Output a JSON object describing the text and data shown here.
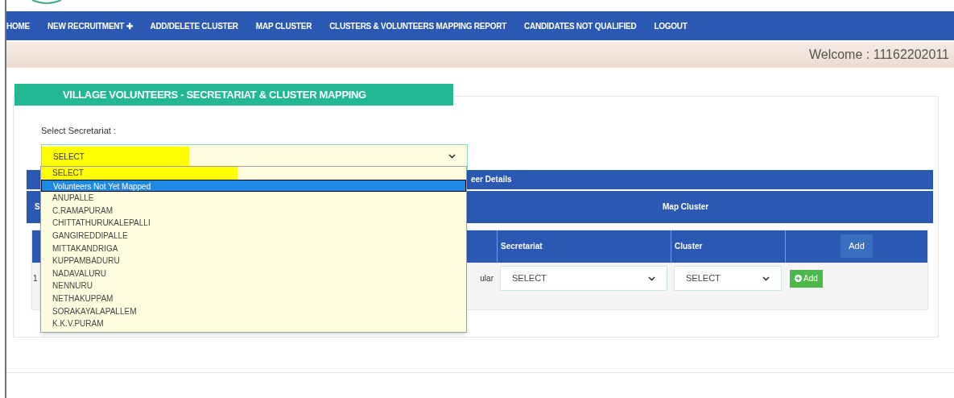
{
  "nav": {
    "items": [
      {
        "label": "HOME"
      },
      {
        "label": "NEW RECRUITMENT ✚"
      },
      {
        "label": "ADD/DELETE CLUSTER"
      },
      {
        "label": "MAP CLUSTER"
      },
      {
        "label": "CLUSTERS & VOLUNTEERS MAPPING REPORT"
      },
      {
        "label": "CANDIDATES NOT QUALIFIED"
      },
      {
        "label": "LOGOUT"
      }
    ]
  },
  "welcome": "Welcome : 11162202011",
  "panel_title": "VILLAGE VOLUNTEERS - SECRETARIAT & CLUSTER MAPPING",
  "secretariat_field": {
    "label": "Select Secretariat :",
    "value": "SELECT",
    "highlighted": true,
    "options": [
      {
        "label": "SELECT",
        "hovered": false,
        "highlighted": true
      },
      {
        "label": "Volunteers Not Yet Mapped",
        "hovered": true,
        "highlighted": false
      },
      {
        "label": "ANUPALLE",
        "hovered": false,
        "highlighted": false
      },
      {
        "label": "C.RAMAPURAM",
        "hovered": false,
        "highlighted": false
      },
      {
        "label": "CHITTATHURUKALEPALLI",
        "hovered": false,
        "highlighted": false
      },
      {
        "label": "GANGIREDDIPALLE",
        "hovered": false,
        "highlighted": false
      },
      {
        "label": "MITTAKANDRIGA",
        "hovered": false,
        "highlighted": false
      },
      {
        "label": "KUPPAMBADURU",
        "hovered": false,
        "highlighted": false
      },
      {
        "label": "NADAVALURU",
        "hovered": false,
        "highlighted": false
      },
      {
        "label": "NENNURU",
        "hovered": false,
        "highlighted": false
      },
      {
        "label": "NETHAKUPPAM",
        "hovered": false,
        "highlighted": false
      },
      {
        "label": "SORAKAYALAPALLEM",
        "hovered": false,
        "highlighted": false
      },
      {
        "label": "K.K.V.PURAM",
        "hovered": false,
        "highlighted": false
      }
    ]
  },
  "table": {
    "caption": "eer Details",
    "group_heading": "Map Cluster",
    "first_heading": "S",
    "columns": [
      "Secretariat",
      "Cluster"
    ],
    "add_header_button": "Add",
    "rows": [
      {
        "number": "1",
        "column_2": "ular",
        "secretariat": "SELECT",
        "cluster": "SELECT",
        "add_button": "Add"
      }
    ]
  }
}
